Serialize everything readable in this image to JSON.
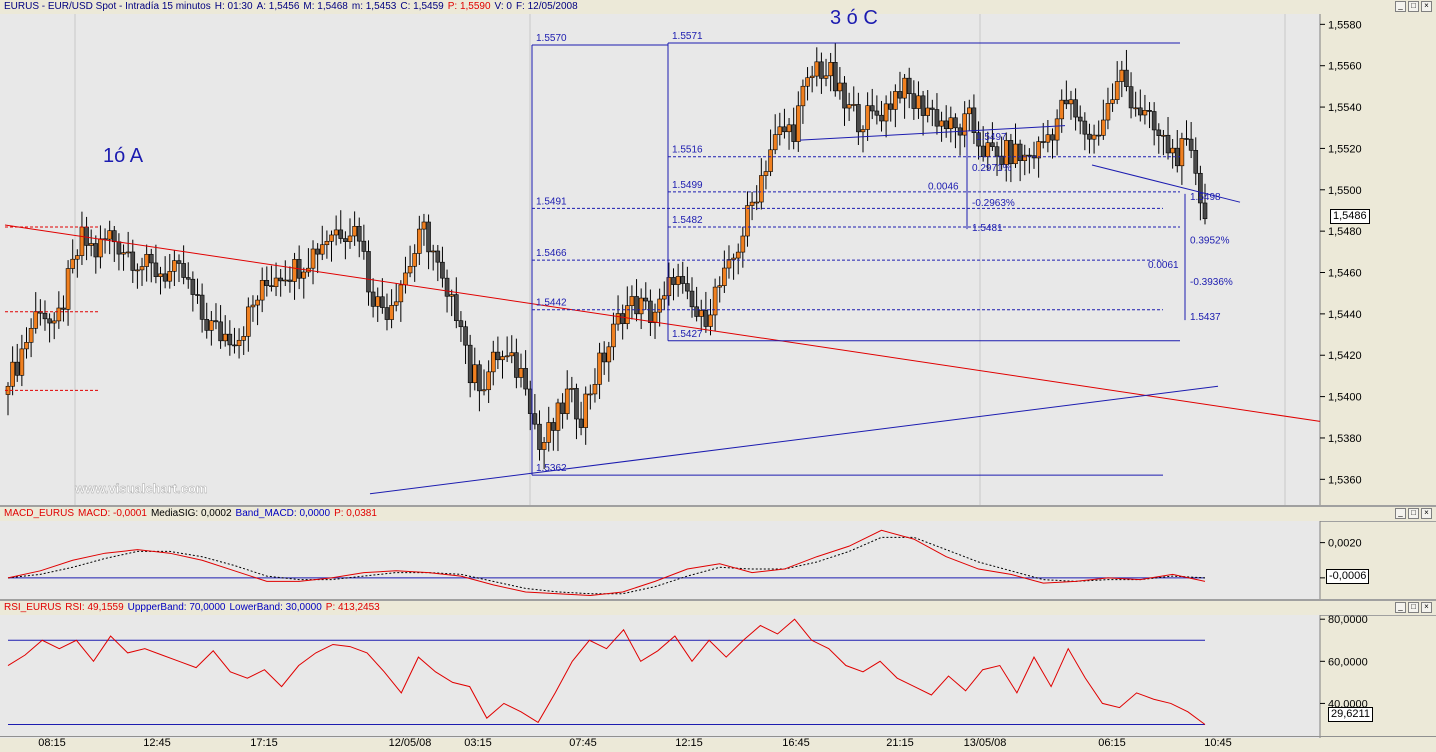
{
  "main": {
    "title_parts": [
      {
        "text": "EURUS - EUR/USD Spot - Intradía 15 minutos",
        "color": "#000080"
      },
      {
        "text": "H: 01:30",
        "color": "#000080"
      },
      {
        "text": "A: 1,5456",
        "color": "#000080"
      },
      {
        "text": "M: 1,5468",
        "color": "#000080"
      },
      {
        "text": "m: 1,5453",
        "color": "#000080"
      },
      {
        "text": "C: 1,5459",
        "color": "#000080"
      },
      {
        "text": "P: 1,5590",
        "color": "#e00000"
      },
      {
        "text": "V: 0",
        "color": "#000080"
      },
      {
        "text": "F: 12/05/2008",
        "color": "#000080"
      }
    ],
    "last_price": "1,5486",
    "watermark": "www.visualchart.com",
    "waves": [
      {
        "text": "1ó A"
      },
      {
        "text": "3 ó C"
      }
    ],
    "fib_labels_left": [
      "1.5570",
      "1.5491",
      "1.5466",
      "1.5442",
      "1.5362"
    ],
    "fib_labels_right": [
      "1.5571",
      "1.5516",
      "1.5499",
      "1.5482",
      "1.5427"
    ],
    "annotations": [
      "0.2971%",
      "0.0046",
      "-0.2963%",
      "1.5481",
      "1.5497",
      "1.5498",
      "0.3952%",
      "0.0061",
      "-0.3936%",
      "1.5437"
    ]
  },
  "macd": {
    "title_parts": [
      {
        "text": "MACD_EURUS",
        "color": "#e00000"
      },
      {
        "text": "MACD: -0,0001",
        "color": "#e00000"
      },
      {
        "text": "MediaSIG: 0,0002",
        "color": "#000000"
      },
      {
        "text": "Band_MACD: 0,0000",
        "color": "#0000c0"
      },
      {
        "text": "P: 0,0381",
        "color": "#e00000"
      }
    ],
    "last_value": "-0,0006"
  },
  "rsi": {
    "title_parts": [
      {
        "text": "RSI_EURUS",
        "color": "#e00000"
      },
      {
        "text": "RSI: 49,1559",
        "color": "#e00000"
      },
      {
        "text": "UppperBand: 70,0000",
        "color": "#0000c0"
      },
      {
        "text": "LowerBand: 30,0000",
        "color": "#0000c0"
      },
      {
        "text": "P: 413,2453",
        "color": "#e00000"
      }
    ],
    "last_value": "29,6211"
  },
  "window_buttons": [
    "_",
    "□",
    "×"
  ],
  "time_labels": [
    "08:15",
    "12:45",
    "17:15",
    "12/05/08",
    "03:15",
    "07:45",
    "12:15",
    "16:45",
    "21:15",
    "13/05/08",
    "06:15",
    "10:45"
  ],
  "chart_data": [
    {
      "type": "candlestick",
      "title": "EURUS - EUR/USD Spot - Intradía 15 minutos",
      "ylim": [
        1.535,
        1.5585
      ],
      "yticks": [
        "1,5360",
        "1,5380",
        "1,5400",
        "1,5420",
        "1,5440",
        "1,5460",
        "1,5480",
        "1,5500",
        "1,5520",
        "1,5540",
        "1,5560",
        "1,5580"
      ],
      "close_anchors": [
        [
          0,
          1.5405
        ],
        [
          4,
          1.5428
        ],
        [
          7,
          1.5445
        ],
        [
          10,
          1.543
        ],
        [
          13,
          1.5455
        ],
        [
          16,
          1.5476
        ],
        [
          19,
          1.547
        ],
        [
          22,
          1.5478
        ],
        [
          26,
          1.547
        ],
        [
          30,
          1.5462
        ],
        [
          34,
          1.546
        ],
        [
          38,
          1.5458
        ],
        [
          42,
          1.5438
        ],
        [
          46,
          1.543
        ],
        [
          50,
          1.543
        ],
        [
          54,
          1.5448
        ],
        [
          58,
          1.546
        ],
        [
          62,
          1.5462
        ],
        [
          66,
          1.547
        ],
        [
          70,
          1.548
        ],
        [
          74,
          1.5482
        ],
        [
          76,
          1.548
        ],
        [
          78,
          1.5455
        ],
        [
          80,
          1.5445
        ],
        [
          82,
          1.5443
        ],
        [
          86,
          1.546
        ],
        [
          90,
          1.548
        ],
        [
          92,
          1.547
        ],
        [
          95,
          1.5445
        ],
        [
          98,
          1.544
        ],
        [
          100,
          1.541
        ],
        [
          103,
          1.5408
        ],
        [
          106,
          1.542
        ],
        [
          109,
          1.5415
        ],
        [
          112,
          1.541
        ],
        [
          115,
          1.5375
        ],
        [
          118,
          1.5385
        ],
        [
          121,
          1.54
        ],
        [
          124,
          1.5392
        ],
        [
          127,
          1.541
        ],
        [
          130,
          1.5425
        ],
        [
          133,
          1.5442
        ],
        [
          136,
          1.5445
        ],
        [
          139,
          1.544
        ],
        [
          142,
          1.5445
        ],
        [
          144,
          1.546
        ],
        [
          147,
          1.5445
        ],
        [
          150,
          1.5436
        ],
        [
          153,
          1.545
        ],
        [
          156,
          1.546
        ],
        [
          159,
          1.548
        ],
        [
          162,
          1.55
        ],
        [
          165,
          1.552
        ],
        [
          167,
          1.5527
        ],
        [
          170,
          1.553
        ],
        [
          172,
          1.5545
        ],
        [
          175,
          1.556
        ],
        [
          178,
          1.5555
        ],
        [
          181,
          1.554
        ],
        [
          184,
          1.5535
        ],
        [
          187,
          1.5535
        ],
        [
          190,
          1.554
        ],
        [
          193,
          1.555
        ],
        [
          196,
          1.5542
        ],
        [
          199,
          1.554
        ],
        [
          202,
          1.5533
        ],
        [
          205,
          1.5528
        ],
        [
          208,
          1.5533
        ],
        [
          211,
          1.552
        ],
        [
          214,
          1.5515
        ],
        [
          217,
          1.5518
        ],
        [
          220,
          1.5515
        ],
        [
          223,
          1.552
        ],
        [
          226,
          1.553
        ],
        [
          229,
          1.5543
        ],
        [
          232,
          1.553
        ],
        [
          235,
          1.5525
        ],
        [
          238,
          1.554
        ],
        [
          241,
          1.5555
        ],
        [
          243,
          1.5545
        ],
        [
          246,
          1.5535
        ],
        [
          249,
          1.5525
        ],
        [
          252,
          1.5518
        ],
        [
          255,
          1.5518
        ],
        [
          257,
          1.551
        ],
        [
          259,
          1.5486
        ]
      ],
      "fib_levels_left": [
        1.557,
        1.5491,
        1.5466,
        1.5442,
        1.5362
      ],
      "fib_levels_right": [
        1.5571,
        1.5516,
        1.5499,
        1.5482,
        1.5427
      ],
      "trendline_red": [
        [
          1.5483,
          0
        ],
        [
          1.5388,
          1
        ]
      ],
      "trendline_blue": [
        [
          1.5353,
          0
        ],
        [
          1.5405,
          1
        ]
      ]
    },
    {
      "type": "line",
      "title": "MACD_EURUS",
      "ylim": [
        -0.0012,
        0.003
      ],
      "yticks": [
        "0,0020",
        "0,0000"
      ],
      "series": [
        {
          "name": "MACD",
          "values": [
            0.0,
            0.0004,
            0.001,
            0.0014,
            0.0016,
            0.0014,
            0.001,
            0.0004,
            -0.0002,
            -0.0002,
            0.0,
            0.0003,
            0.0004,
            0.0003,
            0.0001,
            -0.0004,
            -0.0008,
            -0.0009,
            -0.001,
            -0.0008,
            -0.0002,
            0.0005,
            0.0008,
            0.0003,
            0.0005,
            0.0012,
            0.0018,
            0.0027,
            0.0022,
            0.0012,
            0.0005,
            0.0002,
            -0.0003,
            -0.0002,
            0.0,
            -0.0001,
            0.0002,
            -0.0002
          ]
        },
        {
          "name": "MediaSIG",
          "values": [
            0.0,
            0.0002,
            0.0006,
            0.0011,
            0.0015,
            0.0015,
            0.0012,
            0.0007,
            0.0001,
            -0.0001,
            -0.0001,
            0.0001,
            0.0003,
            0.0003,
            0.0002,
            -0.0002,
            -0.0006,
            -0.0008,
            -0.0009,
            -0.0009,
            -0.0005,
            0.0001,
            0.0006,
            0.0005,
            0.0005,
            0.0009,
            0.0015,
            0.0023,
            0.0023,
            0.0016,
            0.0009,
            0.0004,
            -0.0001,
            -0.0002,
            -0.0001,
            -0.0001,
            0.0001,
            0.0
          ]
        }
      ]
    },
    {
      "type": "line",
      "title": "RSI_EURUS",
      "ylim": [
        25,
        82
      ],
      "yticks": [
        "80,0000",
        "60,0000",
        "40,0000"
      ],
      "series": [
        {
          "name": "RSI",
          "values": [
            58,
            63,
            70,
            66,
            70,
            60,
            72,
            64,
            66,
            63,
            60,
            57,
            65,
            55,
            52,
            56,
            48,
            58,
            64,
            68,
            67,
            64,
            55,
            45,
            62,
            55,
            50,
            48,
            33,
            40,
            36,
            31,
            45,
            60,
            70,
            66,
            75,
            60,
            65,
            72,
            60,
            70,
            62,
            70,
            77,
            73,
            80,
            70,
            66,
            58,
            55,
            60,
            52,
            48,
            44,
            53,
            46,
            56,
            58,
            45,
            62,
            48,
            66,
            52,
            40,
            38,
            45,
            42,
            40,
            36,
            30
          ]
        }
      ]
    }
  ]
}
